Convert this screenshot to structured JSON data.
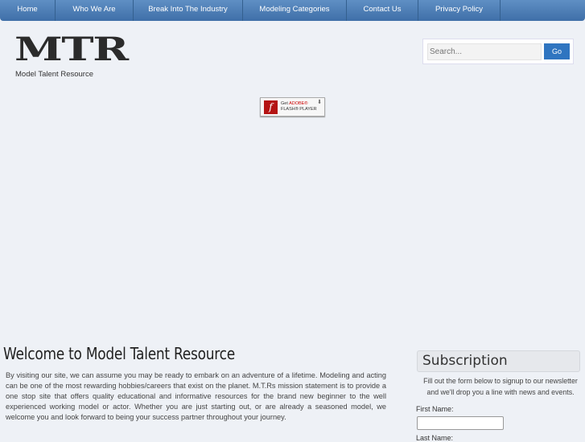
{
  "nav": {
    "items": [
      "Home",
      "Who We Are",
      "Break Into The Industry",
      "Modeling Categories",
      "Contact Us",
      "Privacy Policy"
    ]
  },
  "header": {
    "logo": "MTR",
    "tagline": "Model Talent Resource"
  },
  "search": {
    "placeholder": "Search...",
    "button": "Go"
  },
  "flash": {
    "line1": "Get ",
    "brand": "ADOBE®",
    "line2": "FLASH® PLAYER"
  },
  "main": {
    "title": "Welcome to Model Talent Resource",
    "intro": "By visiting our site, we can assume you may be ready to embark on an adventure of a lifetime. Modeling and acting can be one of the most rewarding hobbies/careers that exist on the planet. M.T.Rs mission statement is to provide a one stop site that offers quality educational and informative resources for the brand new beginner to the well experienced working model or actor. Whether you are just starting out, or are already a seasoned model, we welcome you and look forward to being your success partner throughout your journey."
  },
  "subscription": {
    "title": "Subscription",
    "text": "Fill out the form below to signup to our newsletter and we'll drop you a line with news and events.",
    "first_name_label": "First Name:",
    "first_name_value": "",
    "last_name_label": "Last Name:"
  }
}
